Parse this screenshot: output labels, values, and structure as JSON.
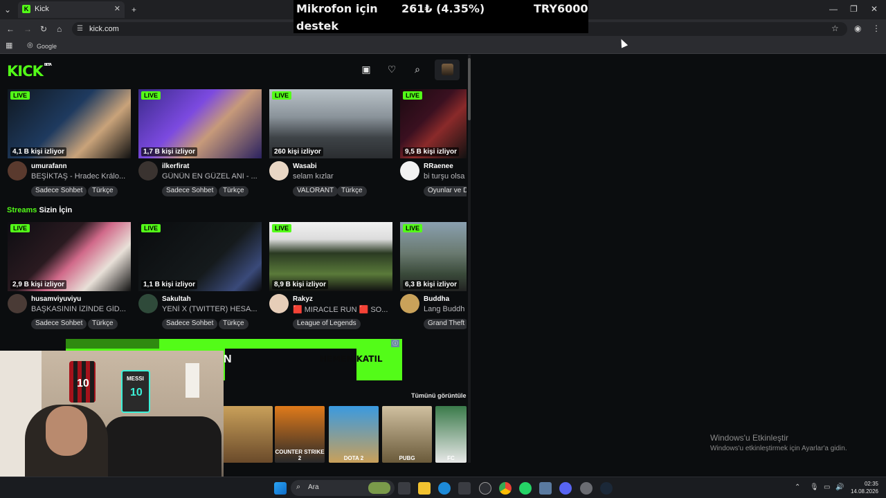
{
  "browser": {
    "tab_title": "Kick",
    "url": "kick.com",
    "bookmark": "Google"
  },
  "ticker": {
    "label_line1": "Mikrofon için",
    "label_line2": "destek",
    "amount": "261₺ (4.35%)",
    "goal": "TRY6000"
  },
  "kick": {
    "logo": "KICK",
    "logo_badge": "BETA",
    "section_title_highlight": "Streams",
    "section_title_rest": "Sizin İçin",
    "see_all": "Tümünü görüntüle",
    "row1": [
      {
        "viewers": "4,1 B kişi izliyor",
        "channel": "umurafann",
        "title": "BEŞİKTAŞ - Hradec Králo...",
        "tags": [
          "Sadece Sohbet",
          "Türkçe"
        ]
      },
      {
        "viewers": "1,7 B kişi izliyor",
        "channel": "ilkerfirat",
        "title": "GÜNÜN EN GÜZEL ANI - ...",
        "tags": [
          "Sadece Sohbet",
          "Türkçe"
        ]
      },
      {
        "viewers": "260 kişi izliyor",
        "channel": "Wasabi",
        "title": "selam kızlar",
        "tags": [
          "VALORANT",
          "Türkçe"
        ]
      },
      {
        "viewers": "9,5 B kişi izliyor",
        "channel": "RRaenee",
        "title": "bi turşu olsa",
        "tags": [
          "Oyunlar ve D"
        ]
      }
    ],
    "row2": [
      {
        "viewers": "2,9 B kişi izliyor",
        "channel": "husamviyuviyu",
        "title": "BAŞKASININ İZİNDE GİD...",
        "tags": [
          "Sadece Sohbet",
          "Türkçe"
        ]
      },
      {
        "viewers": "1,1 B kişi izliyor",
        "channel": "Sakultah",
        "title": "YENİ X (TWITTER) HESA...",
        "tags": [
          "Sadece Sohbet",
          "Türkçe"
        ]
      },
      {
        "viewers": "8,9 B kişi izliyor",
        "channel": "Rakyz",
        "title": "🟥 MIRACLE RUN 🟥 SO...",
        "tags": [
          "League of Legends"
        ]
      },
      {
        "viewers": "6,3 B kişi izliyor",
        "channel": "Buddha",
        "title": "Lang Buddh",
        "tags": [
          "Grand Theft"
        ]
      }
    ],
    "live_label": "LIVE",
    "ad": {
      "button": "HEMEN KATIL",
      "fragment": "N"
    },
    "games": [
      "",
      "COUNTER STRIKE 2",
      "DOTA 2",
      "PUBG",
      "FC"
    ]
  },
  "webcam": {
    "jersey1_num": "10",
    "jersey2_num": "10",
    "jersey2_name": "MESSI"
  },
  "taskbar": {
    "search_label": "Ara",
    "time": "02:35",
    "date": "14.08.2026"
  },
  "watermark": {
    "line1": "Windows'u Etkinleştir",
    "line2": "Windows'u etkinleştirmek için Ayarlar'a gidin."
  }
}
